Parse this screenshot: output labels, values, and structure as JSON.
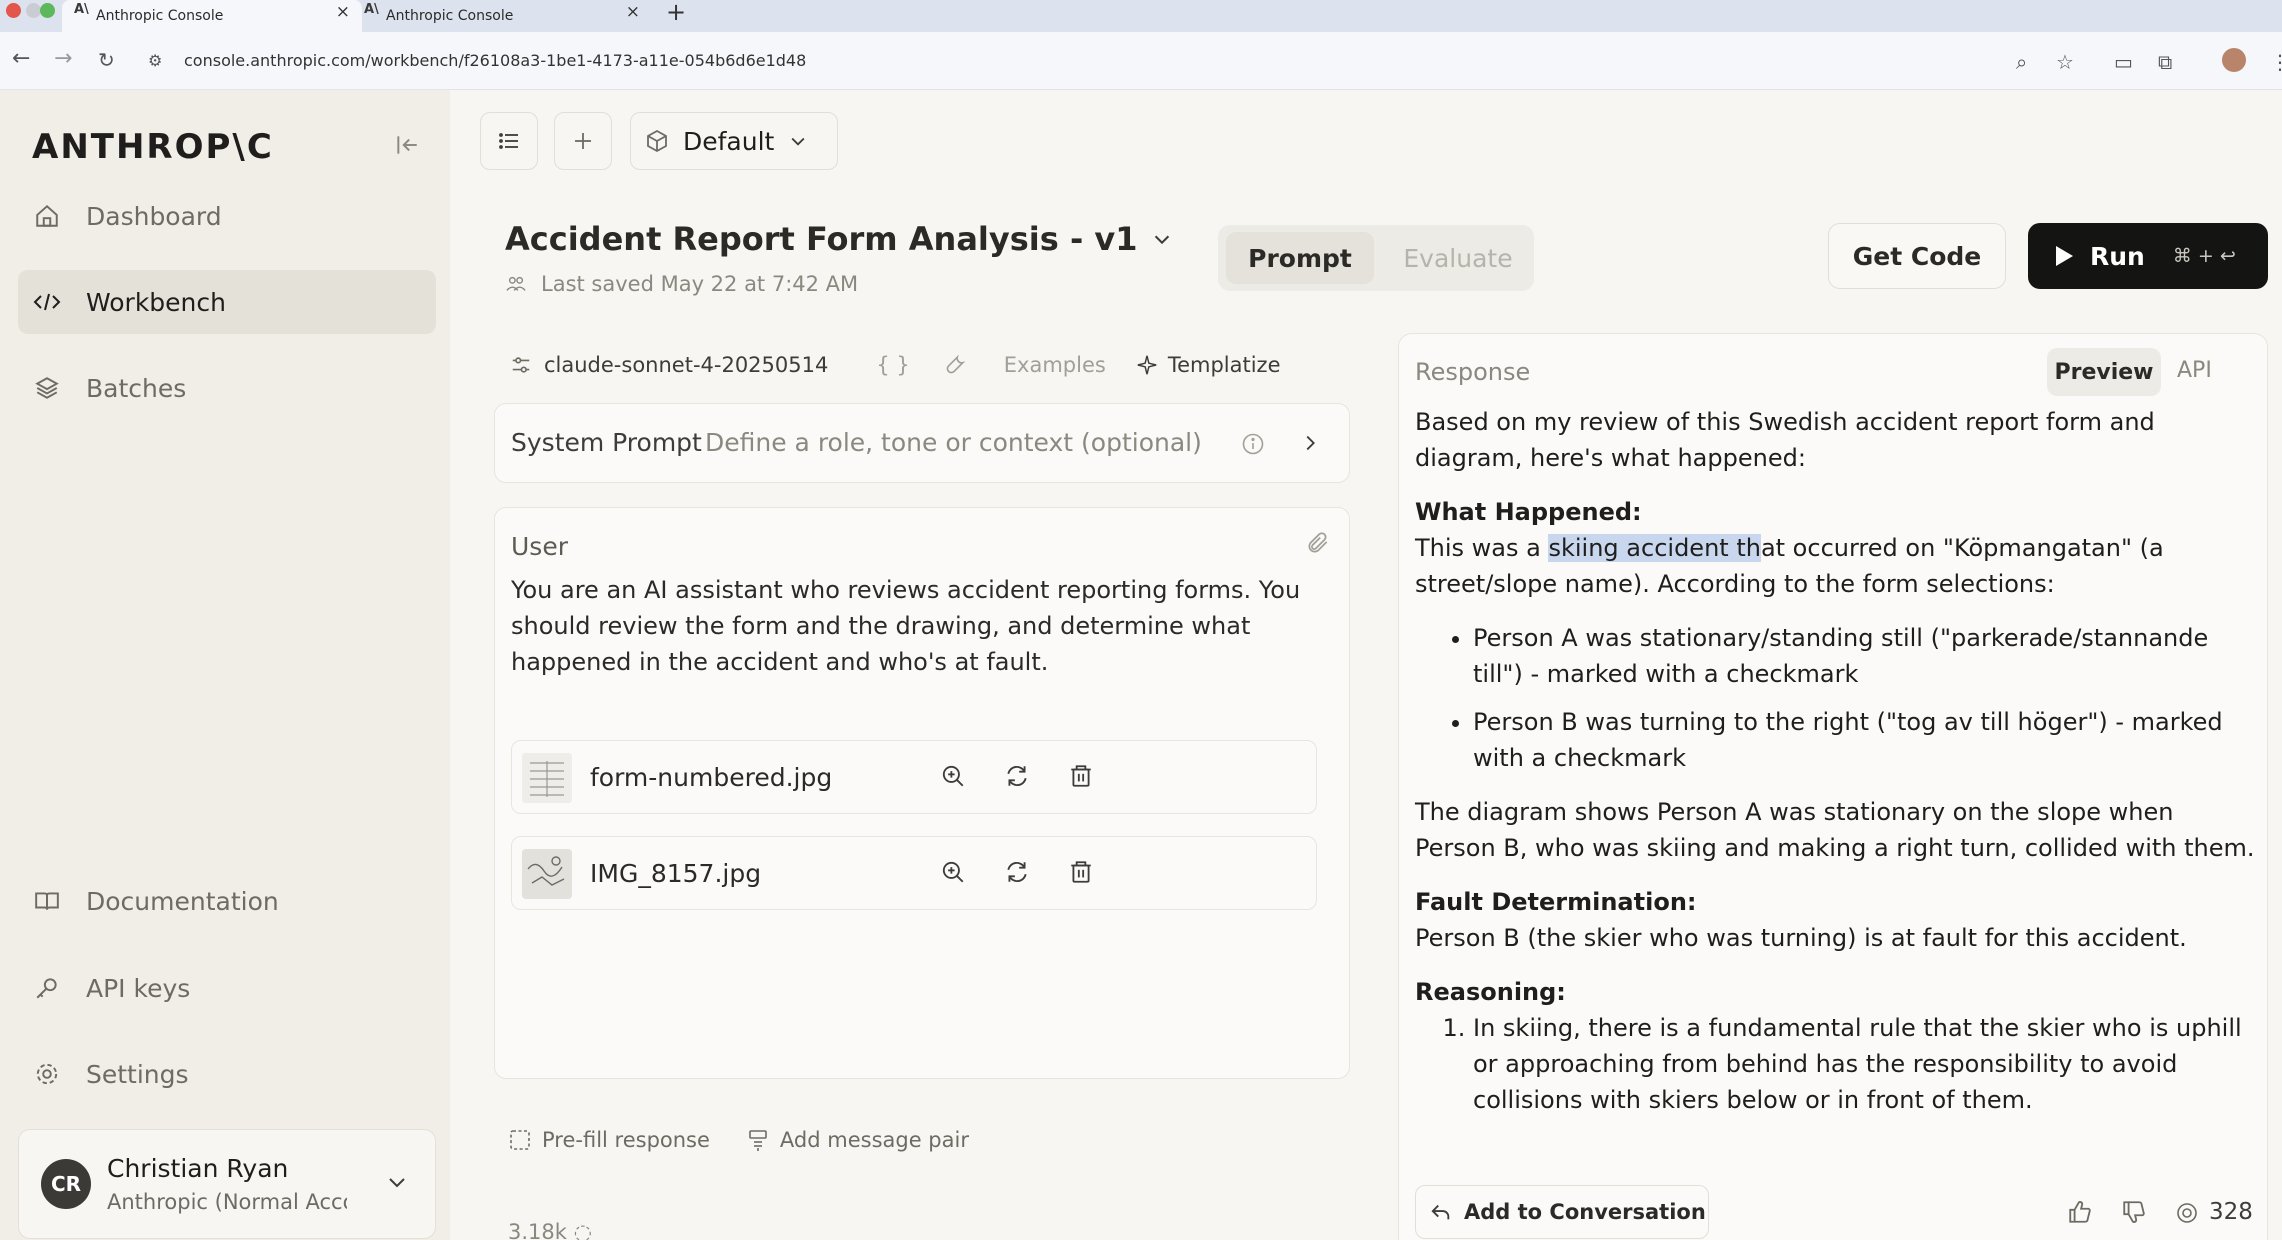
{
  "browser": {
    "tabs": [
      {
        "title": "Anthropic Console",
        "active": true
      },
      {
        "title": "Anthropic Console",
        "active": false
      }
    ],
    "url": "console.anthropic.com/workbench/f26108a3-1be1-4173-a11e-054b6d6e1d48"
  },
  "sidebar": {
    "logo": "ANTHROP\\C",
    "items": [
      {
        "label": "Dashboard",
        "icon": "home-icon",
        "active": false
      },
      {
        "label": "Workbench",
        "icon": "code-icon",
        "active": true
      },
      {
        "label": "Batches",
        "icon": "layers-icon",
        "active": false
      }
    ],
    "bottom_items": [
      {
        "label": "Documentation",
        "icon": "book-icon"
      },
      {
        "label": "API keys",
        "icon": "key-icon"
      },
      {
        "label": "Settings",
        "icon": "gear-icon"
      }
    ],
    "user": {
      "initials": "CR",
      "name": "Christian Ryan",
      "org": "Anthropic (Normal Account)"
    }
  },
  "header": {
    "workspace": "Default",
    "title": "Accident Report Form Analysis - v1",
    "last_saved": "Last saved May 22 at 7:42 AM",
    "tabs": {
      "prompt": "Prompt",
      "evaluate": "Evaluate"
    },
    "get_code": "Get Code",
    "run": {
      "label": "Run",
      "shortcut": "⌘ + ↩"
    }
  },
  "prompt": {
    "model": "claude-sonnet-4-20250514",
    "variables_symbol": "{ }",
    "examples": "Examples",
    "templatize": "Templatize",
    "system": {
      "label": "System Prompt",
      "placeholder": "Define a role, tone or context (optional)"
    },
    "user": {
      "label": "User",
      "text": "You are an AI assistant who reviews accident reporting forms. You should review the form and the drawing, and determine what happened in the accident and who's at fault.",
      "files": [
        {
          "name": "form-numbered.jpg"
        },
        {
          "name": "IMG_8157.jpg"
        }
      ]
    },
    "actions": {
      "prefill": "Pre-fill response",
      "add_pair": "Add message pair"
    },
    "token_count": "3.18k"
  },
  "response": {
    "label": "Response",
    "tabs": {
      "preview": "Preview",
      "api": "API"
    },
    "intro": "Based on my review of this Swedish accident report form and diagram, here's what happened:",
    "what_happened_heading": "What Happened:",
    "what_happened_pre": "This was a ",
    "what_happened_highlight": "skiing accident th",
    "what_happened_post": "at occurred on \"Köpmangatan\" (a street/slope name). According to the form selections:",
    "bullets": [
      "Person A was stationary/standing still (\"parkerade/stannande till\") - marked with a checkmark",
      "Person B was turning to the right (\"tog av till höger\") - marked with a checkmark"
    ],
    "diagram_text": "The diagram shows Person A was stationary on the slope when Person B, who was skiing and making a right turn, collided with them.",
    "fault_heading": "Fault Determination:",
    "fault_text": "Person B (the skier who was turning) is at fault for this accident.",
    "reasoning_heading": "Reasoning:",
    "reasoning": [
      "In skiing, there is a fundamental rule that the skier who is uphill or approaching from behind has the responsibility to avoid collisions with skiers below or in front of them."
    ],
    "add_to_conversation": "Add to Conversation",
    "output_tokens": "328"
  }
}
